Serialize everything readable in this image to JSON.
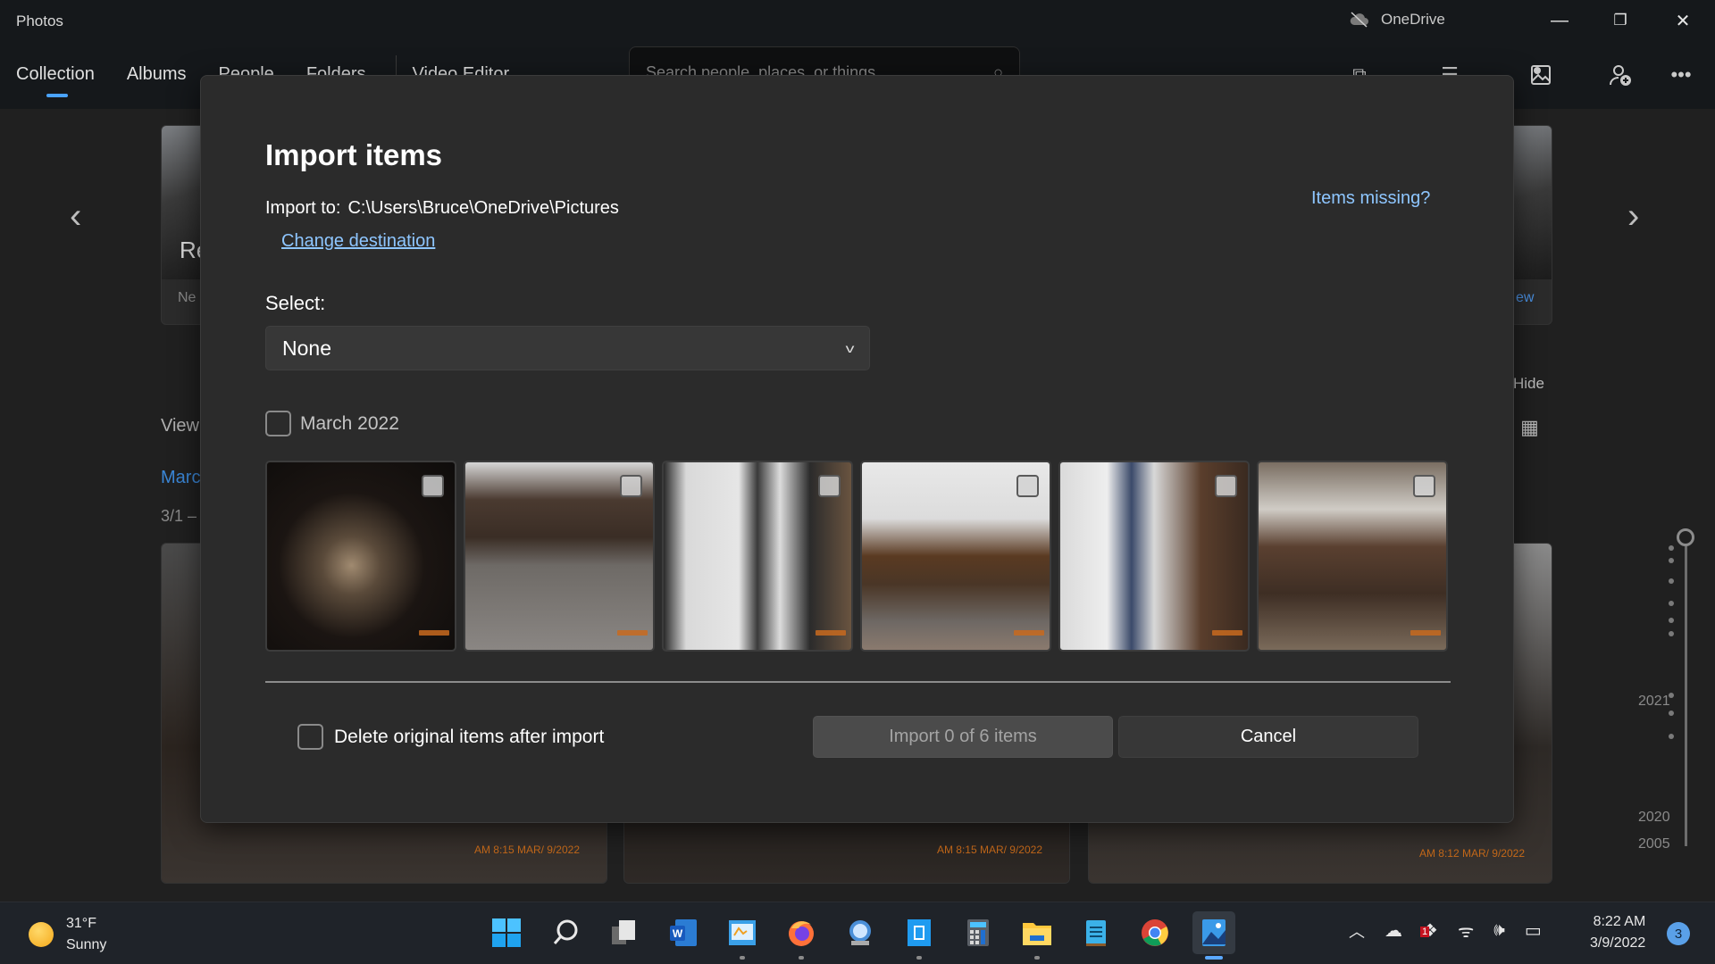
{
  "app": {
    "title": "Photos",
    "onedrive_label": "OneDrive",
    "nav_tabs": [
      {
        "label": "Collection",
        "active": true
      },
      {
        "label": "Albums"
      },
      {
        "label": "People"
      },
      {
        "label": "Folders"
      },
      {
        "label": "Video Editor"
      }
    ],
    "search_placeholder": "Search people, places, or things...",
    "toolbar_icons": [
      "select-collection-icon",
      "multi-select-icon",
      "import-icon",
      "add-person-icon",
      "more-options-icon"
    ],
    "window_controls": {
      "minimize": "—",
      "restore": "❐",
      "close": "✕"
    }
  },
  "background": {
    "memory_card_title_partial": "Re",
    "memory_card_subtitle_partial": "Ne",
    "memory_card_right_link_partial": "ew",
    "view_label_partial": "View",
    "hide_label": "Hide",
    "month_link_partial": "Marc",
    "date_range_partial": "3/1 –",
    "photo_stamps": [
      "AM 8:15 MAR/ 9/2022",
      "AM 8:15 MAR/ 9/2022",
      "AM 8:12 MAR/ 9/2022"
    ],
    "timeline_years": [
      "2021",
      "2020",
      "2005"
    ]
  },
  "dialog": {
    "title": "Import items",
    "import_to_label": "Import to:",
    "import_to_path": "C:\\Users\\Bruce\\OneDrive\\Pictures",
    "change_destination": "Change destination",
    "items_missing": "Items missing?",
    "select_label": "Select:",
    "select_value": "None",
    "group_label": "March 2022",
    "group_checked": false,
    "thumbnails": [
      {
        "subject": "dog on rug",
        "checked": false
      },
      {
        "subject": "recliner and rug",
        "checked": false
      },
      {
        "subject": "hallway doorway",
        "checked": false
      },
      {
        "subject": "living room tv",
        "checked": false
      },
      {
        "subject": "window and piano",
        "checked": false
      },
      {
        "subject": "sofa and lamp",
        "checked": false
      }
    ],
    "delete_original_label": "Delete original items after import",
    "delete_original_checked": false,
    "import_button": "Import 0 of 6 items",
    "cancel_button": "Cancel",
    "selected_count": 0,
    "total_count": 6
  },
  "taskbar": {
    "weather_temp": "31°F",
    "weather_desc": "Sunny",
    "apps": [
      {
        "name": "start-icon"
      },
      {
        "name": "search-icon"
      },
      {
        "name": "task-view-icon"
      },
      {
        "name": "word-icon"
      },
      {
        "name": "control-panel-icon",
        "running": true
      },
      {
        "name": "firefox-icon",
        "running": true
      },
      {
        "name": "remote-desktop-icon"
      },
      {
        "name": "mail-icon",
        "running": true
      },
      {
        "name": "calculator-icon"
      },
      {
        "name": "file-explorer-icon",
        "running": true
      },
      {
        "name": "notepad-icon"
      },
      {
        "name": "chrome-icon"
      },
      {
        "name": "photos-icon",
        "active": true
      }
    ],
    "tray_badge": "1",
    "time": "8:22 AM",
    "date": "3/9/2022",
    "notification_count": "3"
  }
}
